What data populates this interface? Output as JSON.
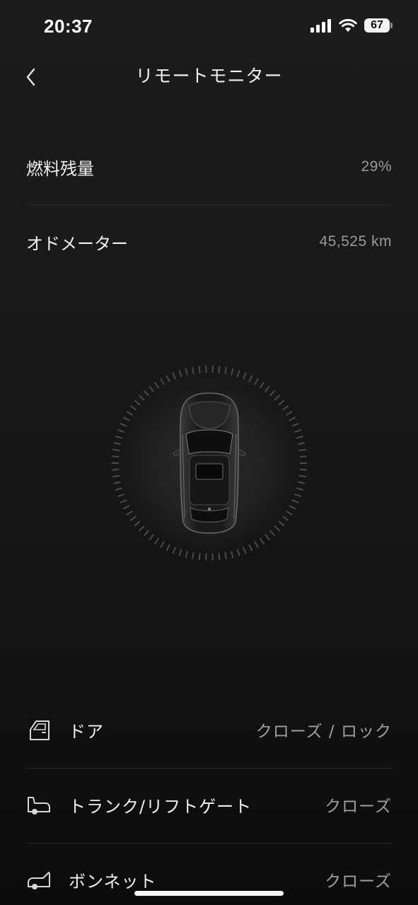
{
  "status_bar": {
    "time": "20:37",
    "battery": "67"
  },
  "header": {
    "title": "リモートモニター"
  },
  "info": [
    {
      "label": "燃料残量",
      "value": "29%"
    },
    {
      "label": "オドメーター",
      "value": "45,525 km"
    }
  ],
  "status_items": [
    {
      "icon": "door-icon",
      "label": "ドア",
      "value": "クローズ / ロック"
    },
    {
      "icon": "trunk-icon",
      "label": "トランク/リフトゲート",
      "value": "クローズ"
    },
    {
      "icon": "bonnet-icon",
      "label": "ボンネット",
      "value": "クローズ"
    }
  ],
  "colors": {
    "background": "#181818",
    "text": "#f0f0f0",
    "muted": "#9a9a9a"
  }
}
